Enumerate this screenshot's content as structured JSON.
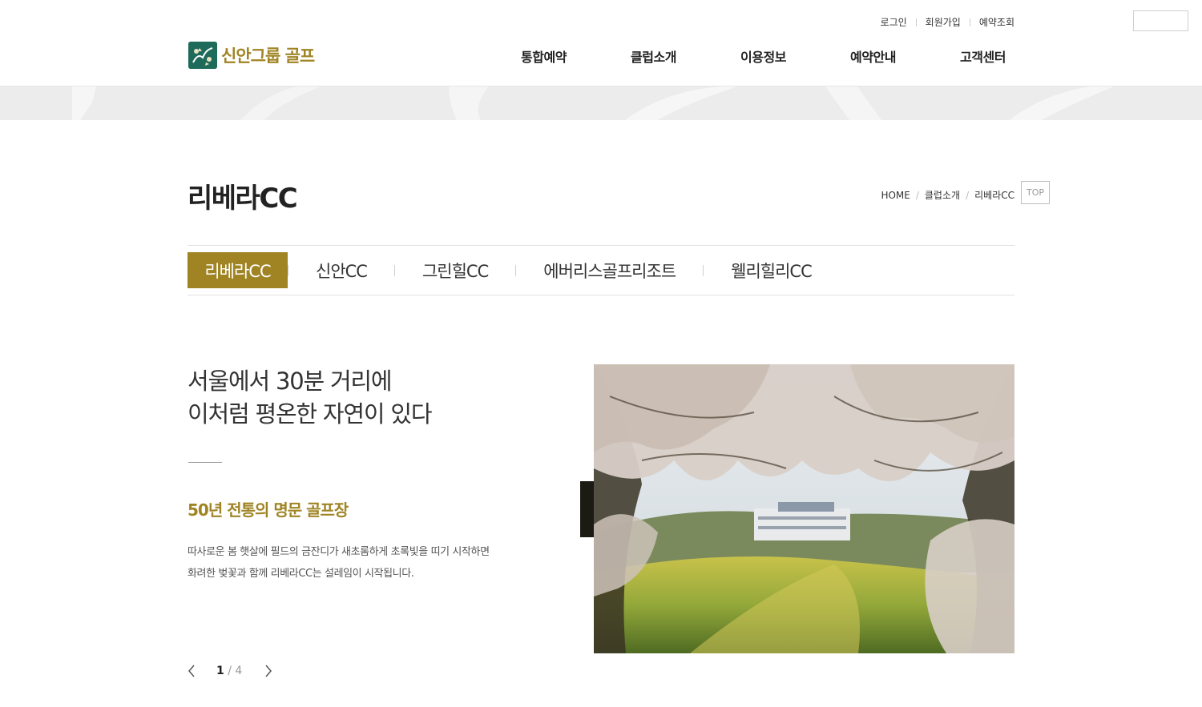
{
  "header": {
    "util_links": [
      "로그인",
      "회원가입",
      "예약조회"
    ],
    "logo_text": "신안그룹 골프",
    "gnb": [
      "통합예약",
      "클럽소개",
      "이용정보",
      "예약안내",
      "고객센터"
    ]
  },
  "title_area": {
    "title": "리베라CC",
    "breadcrumb": [
      "HOME",
      "클럽소개",
      "리베라CC"
    ],
    "top_label": "TOP"
  },
  "tabs": [
    {
      "label": "리베라CC",
      "active": true
    },
    {
      "label": "신안CC",
      "active": false
    },
    {
      "label": "그린힐CC",
      "active": false
    },
    {
      "label": "에버리스골프리조트",
      "active": false
    },
    {
      "label": "웰리힐리CC",
      "active": false
    }
  ],
  "content": {
    "headline_line1": "서울에서 30분 거리에",
    "headline_line2": "이처럼 평온한 자연이 있다",
    "subhead": "50년 전통의 명문 골프장",
    "desc_line1": "따사로운 봄 햇살에 필드의 금잔디가 새초롬하게 초록빛을 띠기 시작하면",
    "desc_line2": "화려한 벚꽃과 함께 리베라CC는 설레임이 시작됩니다."
  },
  "pager": {
    "current": "1",
    "total": "4"
  },
  "colors": {
    "accent": "#a08424",
    "logo_green": "#1f6b5a",
    "banner": "#ececec"
  }
}
